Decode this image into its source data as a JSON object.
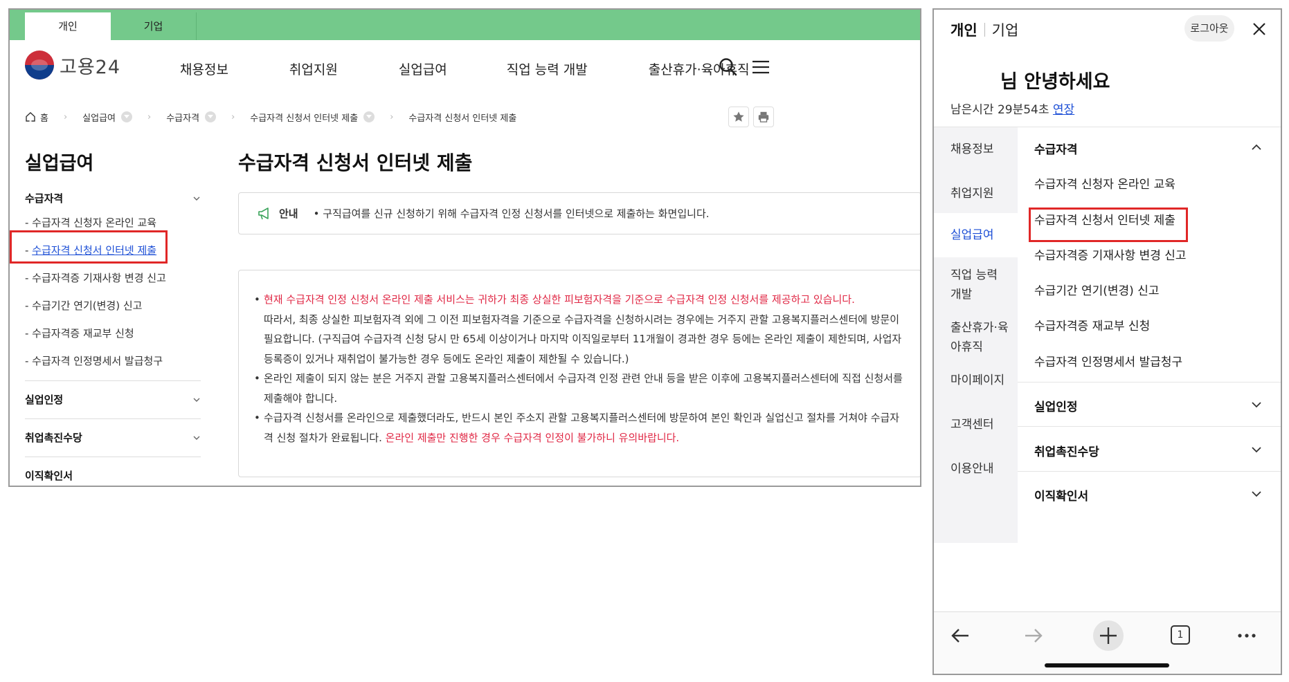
{
  "desktop": {
    "top_tabs": [
      "개인",
      "기업"
    ],
    "logo_text": "고용24",
    "gnb": [
      "채용정보",
      "취업지원",
      "실업급여",
      "직업 능력 개발",
      "출산휴가·육아휴직"
    ],
    "breadcrumb": {
      "home": "홈",
      "items": [
        "실업급여",
        "수급자격",
        "수급자격 신청서 인터넷 제출",
        "수급자격 신청서 인터넷 제출"
      ]
    },
    "side_title": "실업급여",
    "lnb": {
      "group1_title": "수급자격",
      "group1_items": [
        "- 수급자격 신청자 온라인 교육",
        "수급자격 신청서 인터넷 제출",
        "- 수급자격증 기재사항 변경 신고",
        "- 수급기간 연기(변경) 신고",
        "- 수급자격증 재교부 신청",
        "- 수급자격 인정명세서 발급청구"
      ],
      "active_prefix": "- ",
      "group2_title": "실업인정",
      "group3_title": "취업촉진수당",
      "group4_title": "이직확인서"
    },
    "page_title": "수급자격 신청서 인터넷 제출",
    "notice": {
      "label": "안내",
      "text": "• 구직급여를 신규 신청하기 위해 수급자격 인정 신청서를 인터넷으로 제출하는 화면입니다."
    },
    "content": {
      "p1_red": "현재 수급자격 인정 신청서 온라인 제출 서비스는 귀하가 최종 상실한 피보험자격을 기준으로 수급자격 인정 신청서를 제공하고 있습니다.",
      "p1_rest": "따라서, 최종 상실한 피보험자격 외에 그 이전 피보험자격을 기준으로 수급자격을 신청하시려는 경우에는 거주지 관할 고용복지플러스센터에 방문이 필요합니다. (구직급여 수급자격 신청 당시 만 65세 이상이거나 마지막 이직일로부터 11개월이 경과한 경우 등에는 온라인 제출이 제한되며, 사업자등록증이 있거나 재취업이 불가능한 경우 등에도 온라인 제출이 제한될 수 있습니다.)",
      "p2": "온라인 제출이 되지 않는 분은 거주지 관할 고용복지플러스센터에서 수급자격 인정 관련 안내 등을 받은 이후에 고용복지플러스센터에 직접 신청서를 제출해야 합니다.",
      "p3_normal": "수급자격 신청서를 온라인으로 제출했더라도, 반드시 본인 주소지 관할 고용복지플러스센터에 방문하여 본인 확인과 실업신고 절차를 거쳐야 수급자격 신청 절차가 완료됩니다. ",
      "p3_red": "온라인 제출만 진행한 경우 수급자격 인정이 불가하니 유의바랍니다."
    },
    "colors": {
      "topbar": "#74c98b",
      "highlight": "#e02727",
      "link": "#1d4fd6",
      "warning_text": "#e02744"
    }
  },
  "mobile": {
    "tab_personal": "개인",
    "tab_company": "기업",
    "logout": "로그아웃",
    "greeting": "님 안녕하세요",
    "remaining_label": "남은시간 29분54초",
    "extend": "연장",
    "lnb": [
      "채용정보",
      "취업지원",
      "실업급여",
      "직업 능력 개발",
      "출산휴가·육아휴직",
      "마이페이지",
      "고객센터",
      "이용안내"
    ],
    "lnb_lines": {
      "job_ability_1": "직업 능력",
      "job_ability_2": "개발",
      "maternity_1": "출산휴가·육",
      "maternity_2": "아휴직"
    },
    "sub_head": "수급자격",
    "sub_items": [
      "수급자격 신청자 온라인 교육",
      "수급자격 신청서 인터넷 제출",
      "수급자격증 기재사항 변경 신고",
      "수급기간 연기(변경) 신고",
      "수급자격증 재교부 신청",
      "수급자격 인정명세서 발급청구"
    ],
    "groups": [
      "실업인정",
      "취업촉진수당",
      "이직확인서"
    ],
    "tab_count": "1"
  }
}
